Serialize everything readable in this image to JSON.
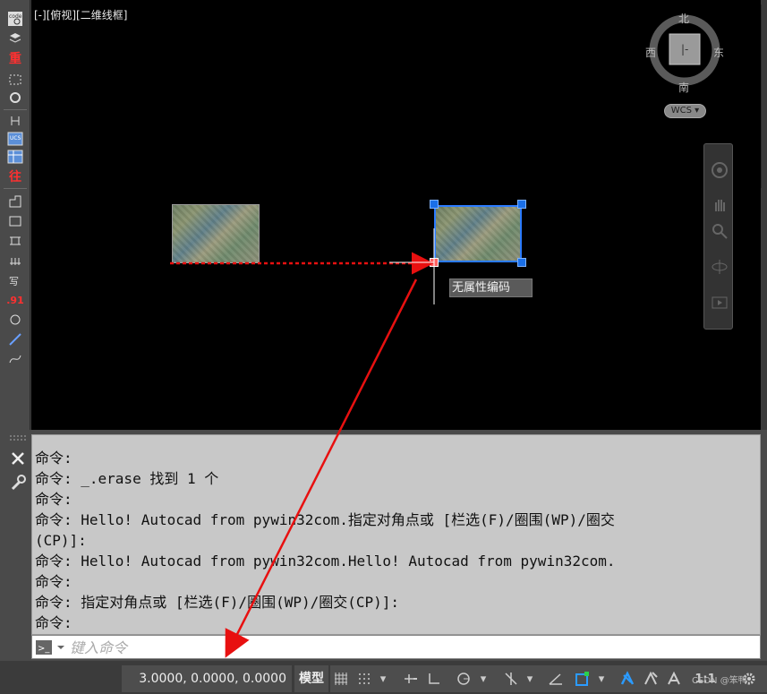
{
  "viewport": {
    "label": "[-][俯视][二维线框]",
    "tooltip": "无属性编码"
  },
  "viewcube": {
    "north": "北",
    "south": "南",
    "east": "东",
    "west": "西",
    "wcs_label": "WCS"
  },
  "left_toolbar": {
    "text_tools": [
      "重",
      "往",
      ".91"
    ]
  },
  "command": {
    "history": [
      "命令:",
      "命令: _.erase 找到 1 个",
      "命令:",
      "命令: Hello! Autocad from pywin32com.指定对角点或 [栏选(F)/圈围(WP)/圈交",
      "(CP)]:",
      "命令: Hello! Autocad from pywin32com.Hello! Autocad from pywin32com.",
      "命令:",
      "命令: 指定对角点或 [栏选(F)/圈围(WP)/圈交(CP)]:",
      "命令:"
    ],
    "input_placeholder": "键入命令"
  },
  "status_bar": {
    "coordinates": "3.0000, 0.0000, 0.0000",
    "model_label": "模型",
    "scale_label": "1:1",
    "watermark": "CSDN @笨鸭"
  },
  "colors": {
    "accent_blue": "#1a6fe8",
    "arrow_red": "#e81010",
    "command_bg": "#c8c8c8"
  }
}
